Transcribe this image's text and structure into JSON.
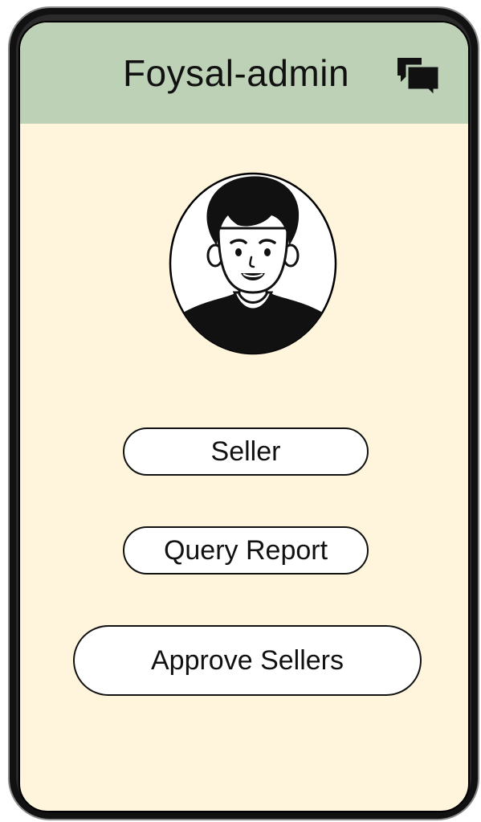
{
  "header": {
    "title": "Foysal-admin",
    "chat_icon": "chat-bubbles-icon",
    "background_color": "#bdd1b6"
  },
  "profile": {
    "avatar_icon": "user-avatar-icon"
  },
  "actions": {
    "seller_label": "Seller",
    "query_report_label": "Query Report",
    "approve_sellers_label": "Approve Sellers"
  },
  "theme": {
    "screen_background": "#fff5dc",
    "button_background": "#ffffff",
    "text_color": "#111111"
  }
}
